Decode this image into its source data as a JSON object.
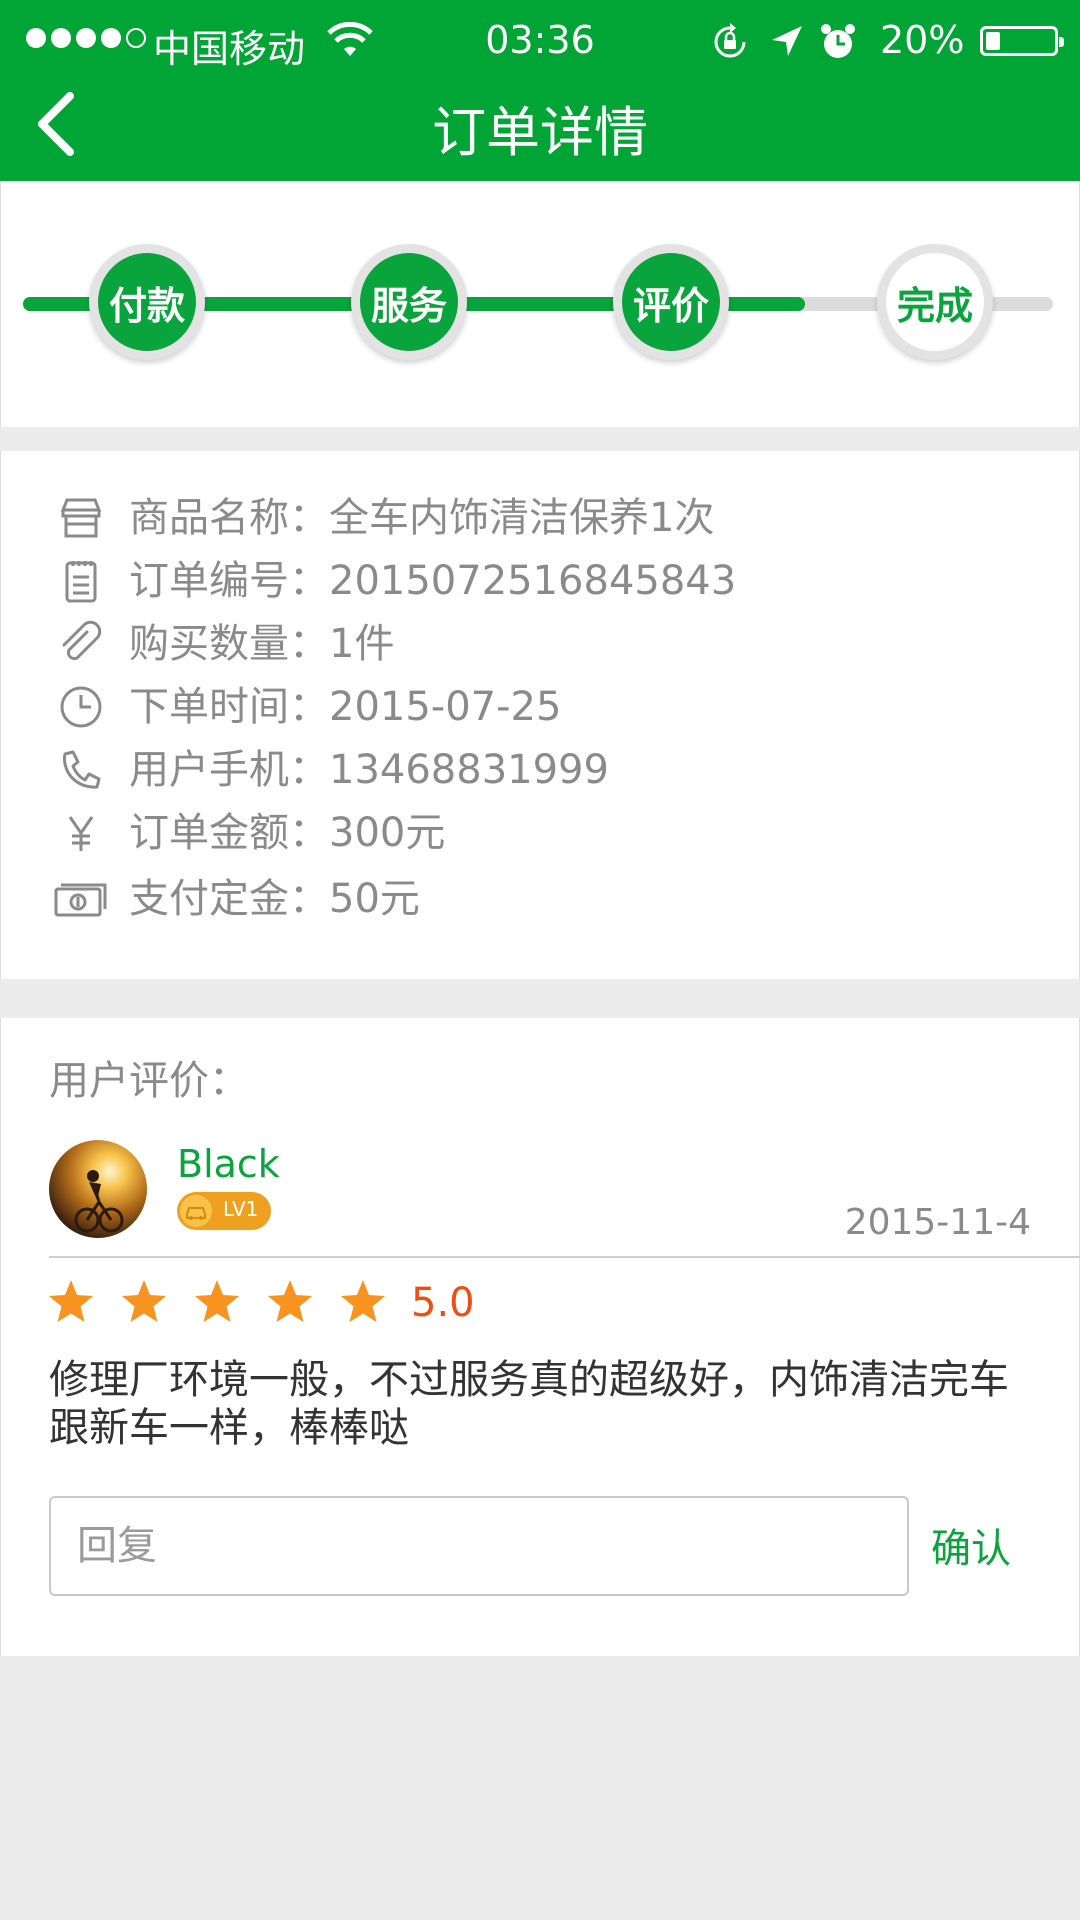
{
  "status_bar": {
    "carrier": "中国移动",
    "time": "03:36",
    "battery": "20%",
    "icons": [
      "signal-icon",
      "wifi-icon",
      "rotation-lock-icon",
      "location-icon",
      "alarm-icon",
      "battery-icon"
    ]
  },
  "header": {
    "title": "订单详情",
    "back_icon": "chevron-left-icon"
  },
  "colors": {
    "brand": "#00a535",
    "accent_green": "#0aa43c",
    "star": "#f7931e",
    "rating": "#f04e10",
    "badge": "#f0a020"
  },
  "steps": [
    {
      "label": "付款",
      "done": true
    },
    {
      "label": "服务",
      "done": true
    },
    {
      "label": "评价",
      "done": true
    },
    {
      "label": "完成",
      "done": false
    }
  ],
  "order_info": [
    {
      "icon": "store-icon",
      "text": "商品名称：全车内饰清洁保养1次"
    },
    {
      "icon": "clipboard-icon",
      "text": "订单编号：2015072516845843"
    },
    {
      "icon": "paperclip-icon",
      "text": "购买数量：1件"
    },
    {
      "icon": "clock-icon",
      "text": "下单时间：2015-07-25"
    },
    {
      "icon": "phone-icon",
      "text": "用户手机：13468831999"
    },
    {
      "icon": "yen-icon",
      "text": "订单金额：300元"
    },
    {
      "icon": "banknote-icon",
      "text": "支付定金：50元"
    }
  ],
  "review": {
    "heading": "用户评价：",
    "user_name": "Black",
    "level": "LV1",
    "date": "2015-11-4",
    "stars": 5,
    "rating": "5.0",
    "text": "修理厂环境一般，不过服务真的超级好，内饰清洁完车跟新车一样，棒棒哒",
    "reply_placeholder": "回复",
    "confirm_label": "确认"
  }
}
